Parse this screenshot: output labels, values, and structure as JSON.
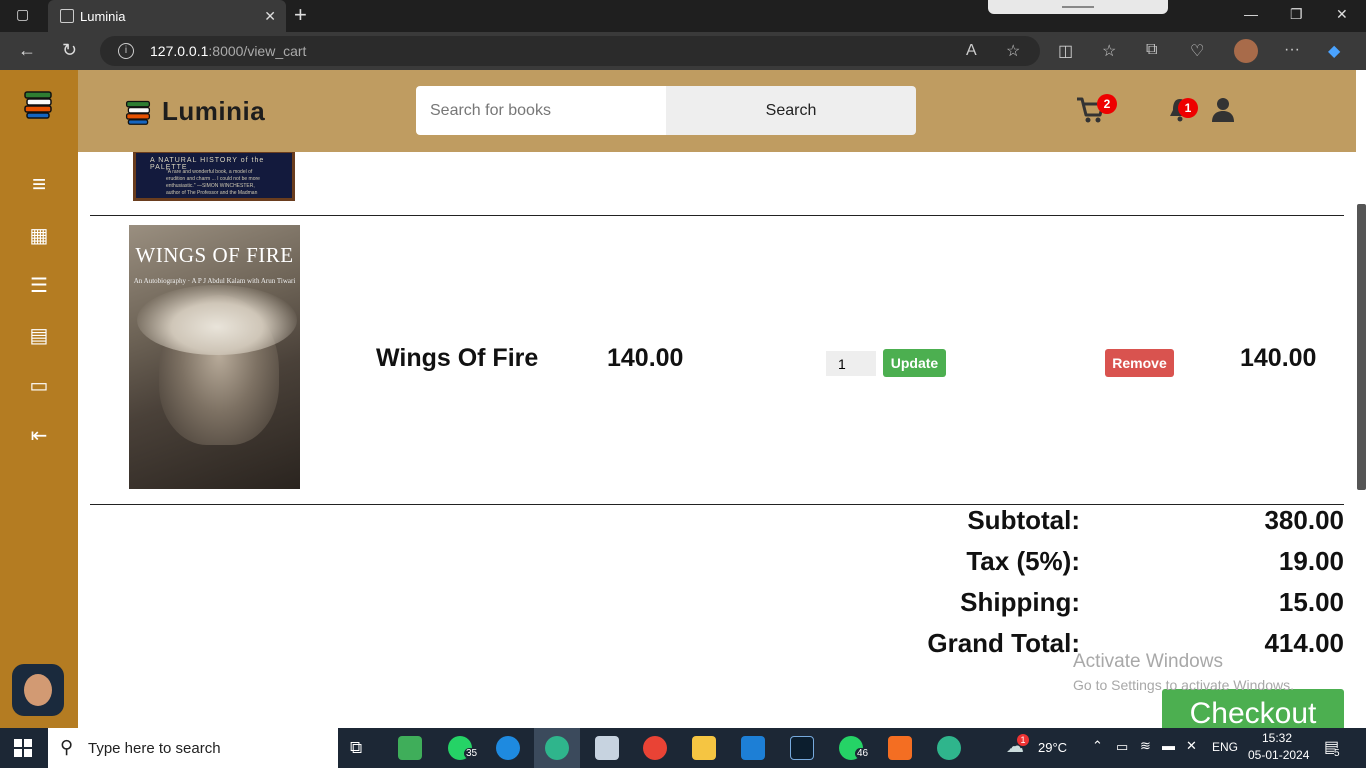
{
  "browser": {
    "tab_title": "Luminia",
    "url_host": "127.0.0.1",
    "url_path": ":8000/view_cart"
  },
  "header": {
    "brand": "Luminia",
    "search_placeholder": "Search for books",
    "search_button": "Search",
    "cart_count": "2",
    "notification_count": "1"
  },
  "prev_book": {
    "cover_line1": "A NATURAL HISTORY of the PALETTE",
    "cover_line2": "\"A rare and wonderful book, a model of erudition and charm ... I could not be more enthusiastic.\" —SIMON WINCHESTER, author of The Professor and the Madman"
  },
  "cart_item": {
    "cover_title": "WINGS OF FIRE",
    "cover_sub": "An Autobiography · A P J Abdul Kalam with Arun Tiwari",
    "name": "Wings Of Fire",
    "price": "140.00",
    "quantity": "1",
    "update_label": "Update",
    "remove_label": "Remove",
    "total": "140.00"
  },
  "summary": {
    "subtotal_label": "Subtotal:",
    "subtotal_value": "380.00",
    "tax_label": "Tax (5%):",
    "tax_value": "19.00",
    "shipping_label": "Shipping:",
    "shipping_value": "15.00",
    "grand_total_label": "Grand Total:",
    "grand_total_value": "414.00"
  },
  "checkout_label": "Checkout",
  "watermark": {
    "line1": "Activate Windows",
    "line2": "Go to Settings to activate Windows."
  },
  "taskbar": {
    "search_text": "Type here to search",
    "whatsapp_count_1": "35",
    "whatsapp_count_2": "46",
    "weather_badge": "1",
    "temperature": "29°C",
    "language": "ENG",
    "time": "15:32",
    "date": "05-01-2024",
    "notification_count": "5"
  },
  "colors": {
    "sidebar": "#b47c22",
    "header": "#bf9c61",
    "update_green": "#4caf50",
    "remove_red": "#d9534f"
  }
}
